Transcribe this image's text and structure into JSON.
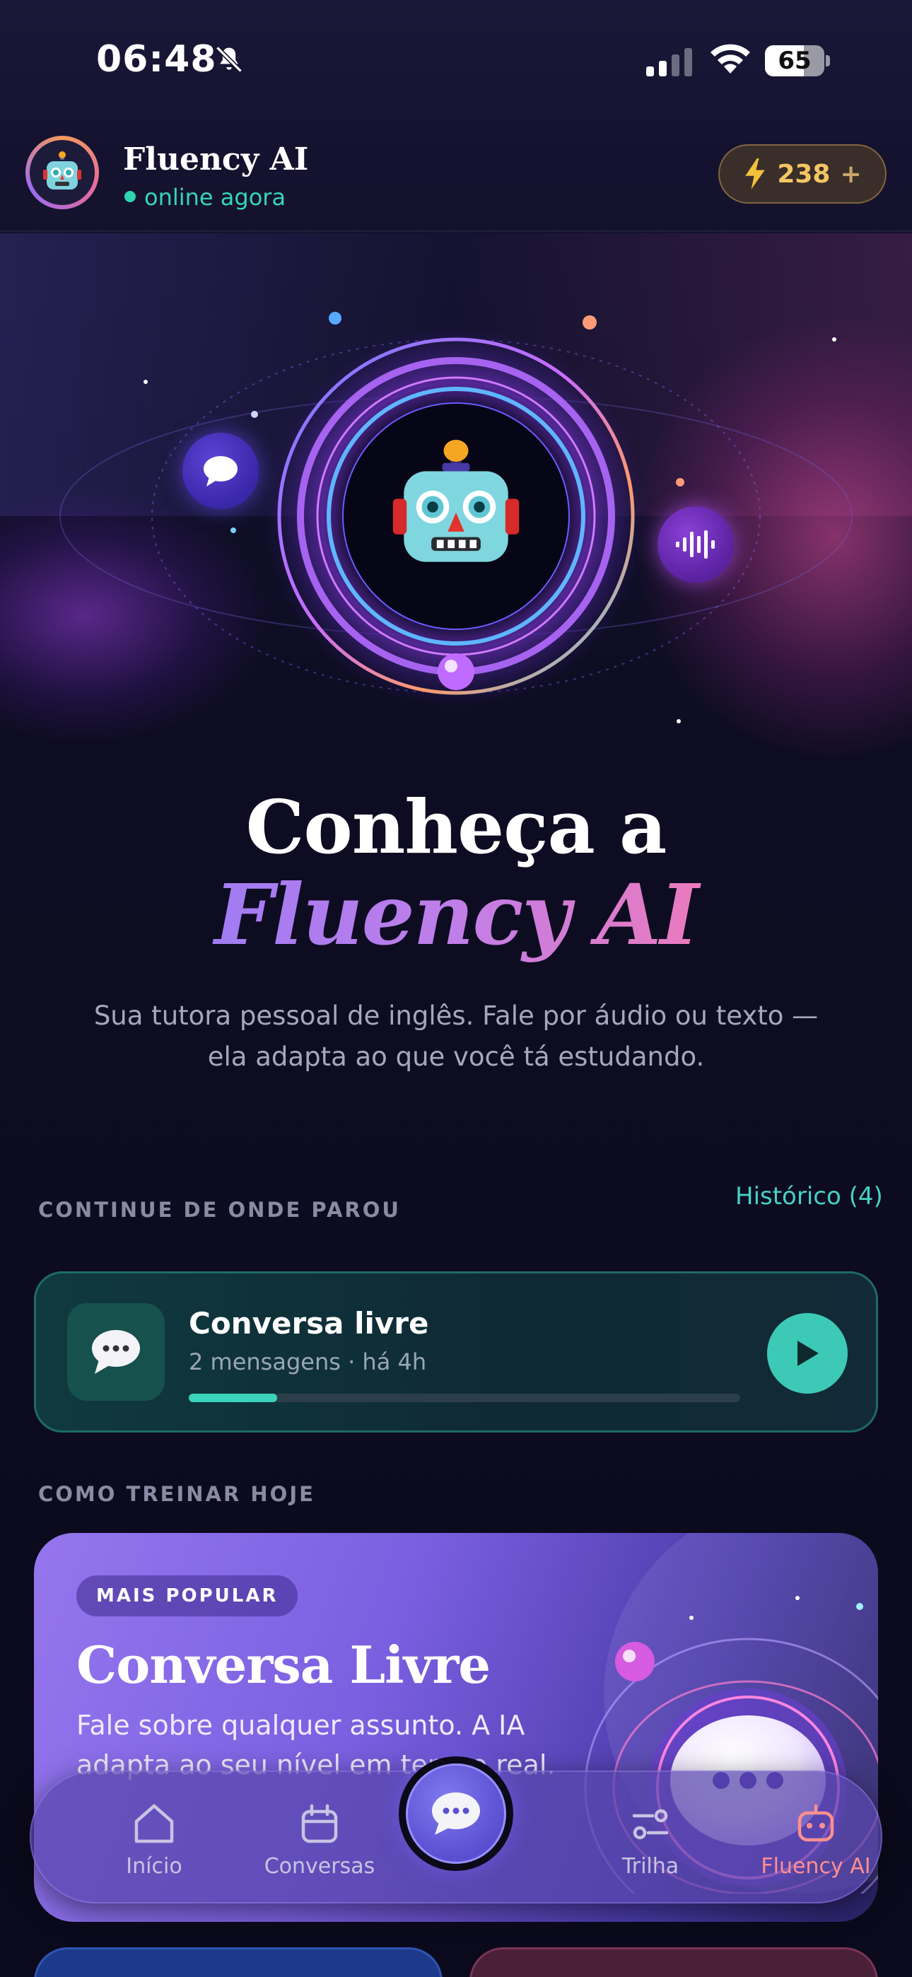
{
  "status_bar": {
    "time": "06:48",
    "battery_level": "65",
    "battery_fraction": 0.65
  },
  "header": {
    "app_name": "Fluency AI",
    "status": "online agora",
    "credits": "238",
    "credits_add": "+"
  },
  "hero": {
    "title_line1": "Conheça a",
    "title_line2": "Fluency AI",
    "subtitle": "Sua tutora pessoal de inglês. Fale por áudio ou texto — ela adapta ao que você tá estudando."
  },
  "continue_section": {
    "label": "CONTINUE DE ONDE PAROU",
    "history_link": "Histórico (4)",
    "card": {
      "title": "Conversa livre",
      "meta": "2 mensagens · há 4h",
      "progress": 0.16
    }
  },
  "train_section": {
    "label": "COMO TREINAR HOJE",
    "card": {
      "badge": "MAIS POPULAR",
      "title": "Conversa Livre",
      "description": "Fale sobre qualquer assunto. A IA adapta ao seu nível em tempo real."
    }
  },
  "tab_bar": {
    "tabs": [
      {
        "label": "Início",
        "icon": "home-icon"
      },
      {
        "label": "Conversas",
        "icon": "calendar-icon"
      },
      {
        "label": "",
        "icon": "chat-bubble-icon"
      },
      {
        "label": "Trilha",
        "icon": "sliders-icon"
      },
      {
        "label": "Fluency AI",
        "icon": "robot-icon"
      }
    ],
    "active_color": "#ff8f8f"
  },
  "colors": {
    "accent_teal": "#3ccab7",
    "accent_purple": "#9c7bf5",
    "accent_pink": "#f07ab8",
    "gold": "#f3c664"
  }
}
